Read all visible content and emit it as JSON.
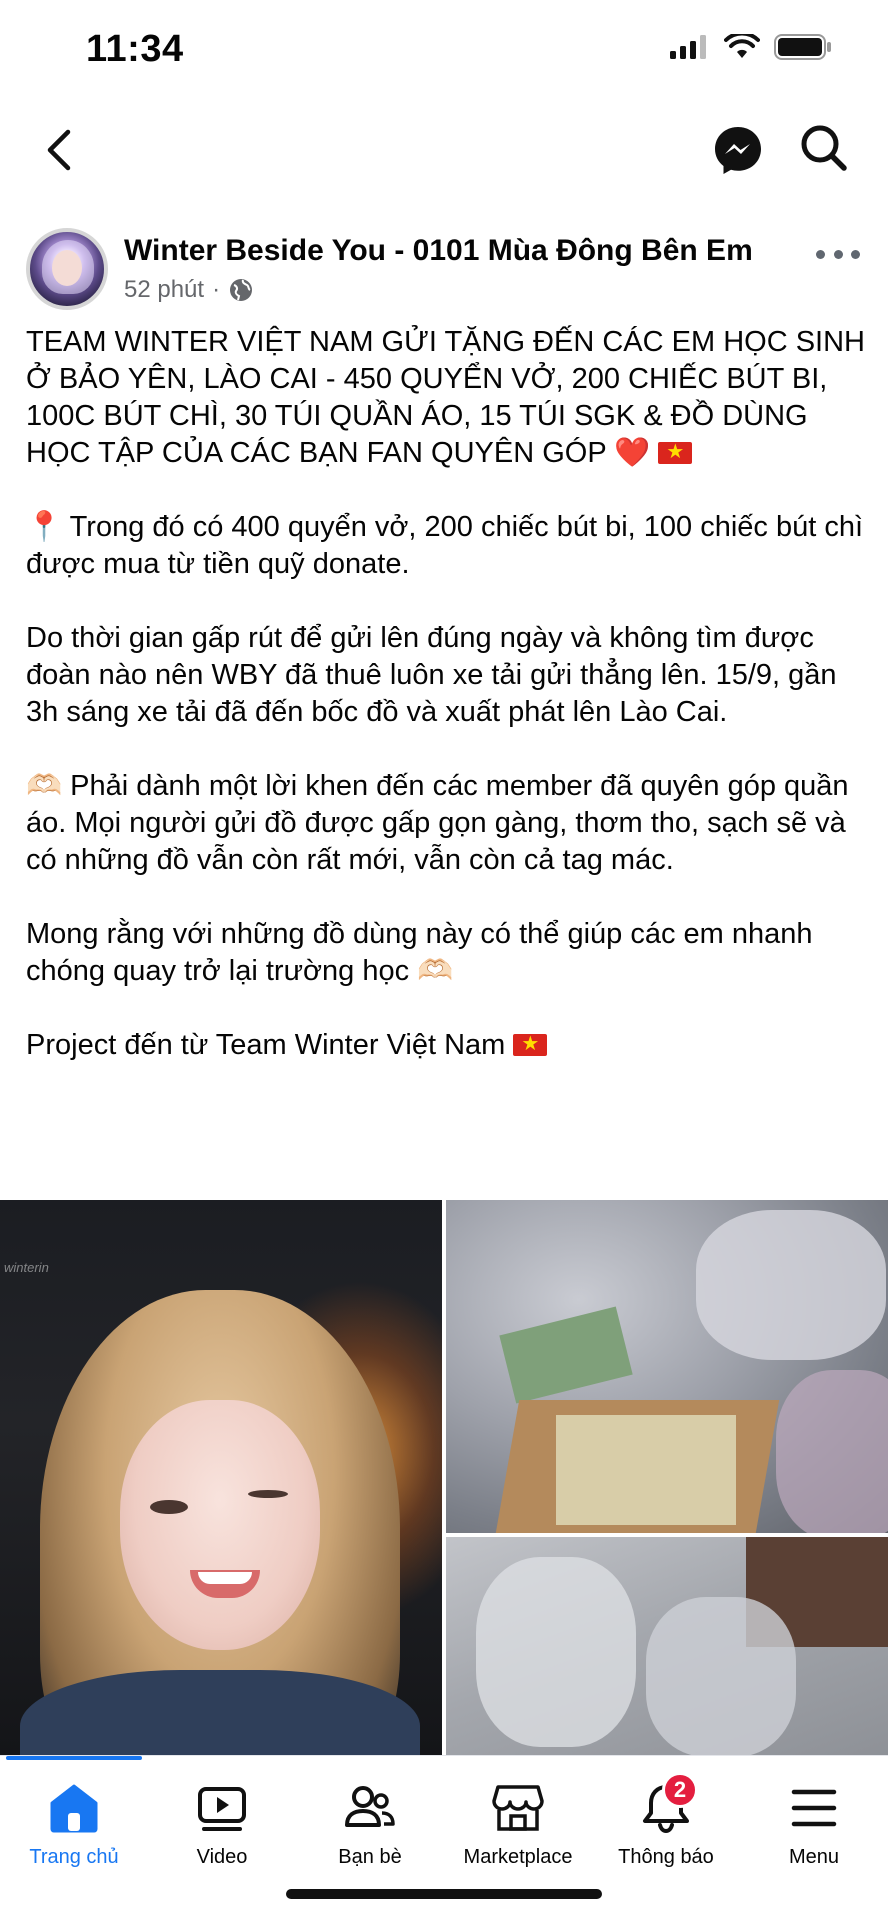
{
  "status_bar": {
    "time": "11:34"
  },
  "top_nav": {
    "back_icon": "chevron-left-icon",
    "messenger_icon": "messenger-icon",
    "search_icon": "search-icon"
  },
  "post": {
    "page_name": "Winter Beside You - 0101 Mùa Đông Bên Em",
    "time_ago": "52 phút",
    "separator": "·",
    "paragraphs": {
      "p1": "TEAM WINTER VIỆT NAM GỬI TẶNG ĐẾN CÁC EM HỌC SINH Ở BẢO YÊN, LÀO CAI - 450 QUYỂN VỞ, 200 CHIẾC BÚT BI, 100C BÚT CHÌ, 30 TÚI QUẦN ÁO, 15 TÚI SGK & ĐỒ DÙNG HỌC TẬP CỦA CÁC BẠN FAN QUYÊN GÓP",
      "p2": "Trong đó có 400 quyển vở, 200 chiếc bút bi, 100 chiếc bút chì được mua từ tiền quỹ donate.",
      "p3": "Do thời gian gấp rút để gửi lên đúng ngày và không tìm được đoàn nào nên WBY đã thuê luôn xe tải gửi thẳng lên. 15/9, gần 3h sáng xe tải đã đến bốc đồ và xuất phát lên Lào Cai.",
      "p4": "Phải dành một lời khen đến các member đã quyên góp quần áo. Mọi người gửi đồ được gấp gọn gàng, thơm tho, sạch sẽ và có những đồ vẫn còn rất mới, vẫn còn cả tag mác.",
      "p5": "Mong rằng với những đồ dùng này có thể giúp các em nhanh chóng quay trở lại trường học",
      "p6": "Project đến từ Team Winter Việt Nam"
    },
    "emoji": {
      "heart": "❤️",
      "pin": "📍",
      "hands": "🫶🏻"
    },
    "photo_watermark": "winterin"
  },
  "tab_bar": {
    "tabs": [
      {
        "label": "Trang chủ",
        "icon": "home-icon",
        "active": true
      },
      {
        "label": "Video",
        "icon": "video-icon"
      },
      {
        "label": "Bạn bè",
        "icon": "friends-icon"
      },
      {
        "label": "Marketplace",
        "icon": "marketplace-icon"
      },
      {
        "label": "Thông báo",
        "icon": "bell-icon",
        "badge": "2"
      },
      {
        "label": "Menu",
        "icon": "menu-icon"
      }
    ]
  },
  "colors": {
    "accent": "#1877f2",
    "badge": "#e41e3f",
    "meta_text": "#65676b"
  }
}
